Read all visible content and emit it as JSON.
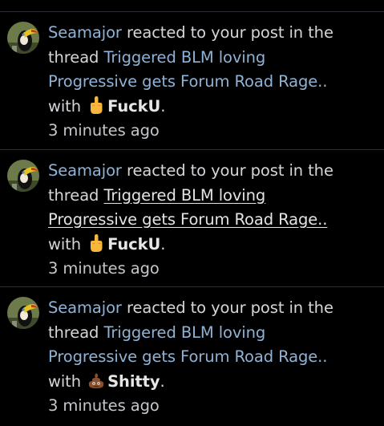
{
  "alerts": [
    {
      "user": "Seamajor",
      "action": "reacted to your post in the thread",
      "thread_line1": "Triggered BLM loving",
      "thread_line2": "Progressive gets Forum Road Rage..",
      "with_label": "with",
      "reaction_icon": "middle-finger-icon",
      "reaction": "FuckU",
      "period": ".",
      "time": "3 minutes ago"
    },
    {
      "user": "Seamajor",
      "action": "reacted to your post in the thread",
      "thread_line1": "Triggered BLM loving",
      "thread_line2": "Progressive gets Forum Road Rage..",
      "with_label": "with",
      "reaction_icon": "middle-finger-icon",
      "reaction": "FuckU",
      "period": ".",
      "time": "3 minutes ago"
    },
    {
      "user": "Seamajor",
      "action": "reacted to your post in the thread",
      "thread_line1": "Triggered BLM loving",
      "thread_line2": "Progressive gets Forum Road Rage..",
      "with_label": "with",
      "reaction_icon": "poop-icon",
      "reaction": "Shitty",
      "period": ".",
      "time": "3 minutes ago"
    }
  ],
  "colors": {
    "link": "#8fb3d6",
    "visited_link": "#e4e4e4",
    "background": "#000000",
    "divider": "#2b2f36"
  }
}
